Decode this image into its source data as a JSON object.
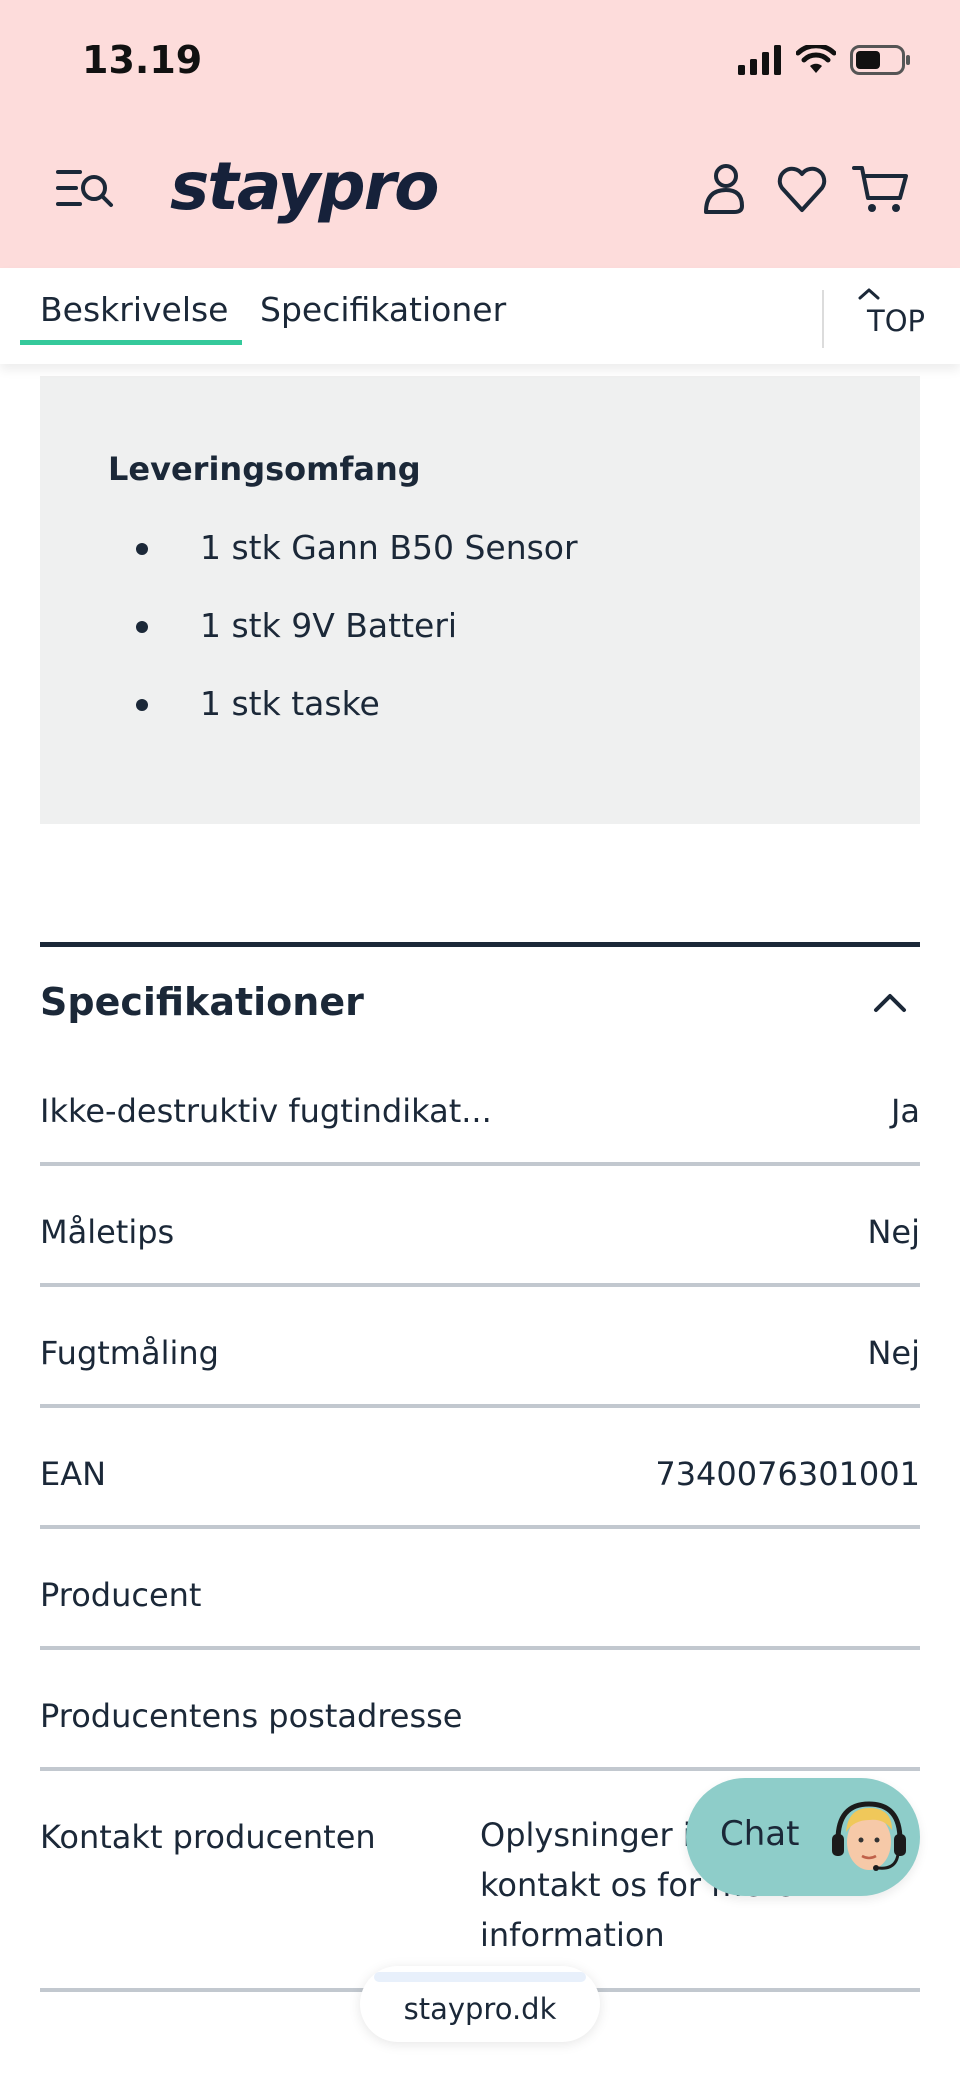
{
  "status_bar": {
    "time": "13.19"
  },
  "header": {
    "logo": "staypro",
    "icons": [
      "menu-search-icon",
      "user-icon",
      "heart-icon",
      "cart-icon"
    ]
  },
  "tabs": {
    "items": [
      "Beskrivelse",
      "Specifikationer"
    ],
    "active": "Beskrivelse",
    "top_label": "TOP"
  },
  "delivery": {
    "title": "Leveringsomfang",
    "items": [
      "1 stk Gann B50 Sensor",
      "1 stk 9V Batteri",
      "1 stk taske"
    ]
  },
  "specs": {
    "title": "Specifikationer",
    "rows": [
      {
        "label": "Ikke-destruktiv fugtindikat...",
        "value": "Ja"
      },
      {
        "label": "Måletips",
        "value": "Nej"
      },
      {
        "label": "Fugtmåling",
        "value": "Nej"
      },
      {
        "label": "EAN",
        "value": "7340076301001"
      },
      {
        "label": "Producent",
        "value": ""
      },
      {
        "label": "Producentens postadresse",
        "value": ""
      },
      {
        "label": "Kontakt producenten",
        "value_lines": [
          "Oplysninger i",
          "kontakt os for mere",
          "information"
        ]
      }
    ]
  },
  "chat": {
    "label": "Chat"
  },
  "browser": {
    "url": "staypro.dk"
  },
  "colors": {
    "header_bg": "#fddcdb",
    "tab_accent": "#35c99b",
    "box_bg": "#eff0f0",
    "text": "#1b2838",
    "chat_bg": "#8ecdc9"
  }
}
